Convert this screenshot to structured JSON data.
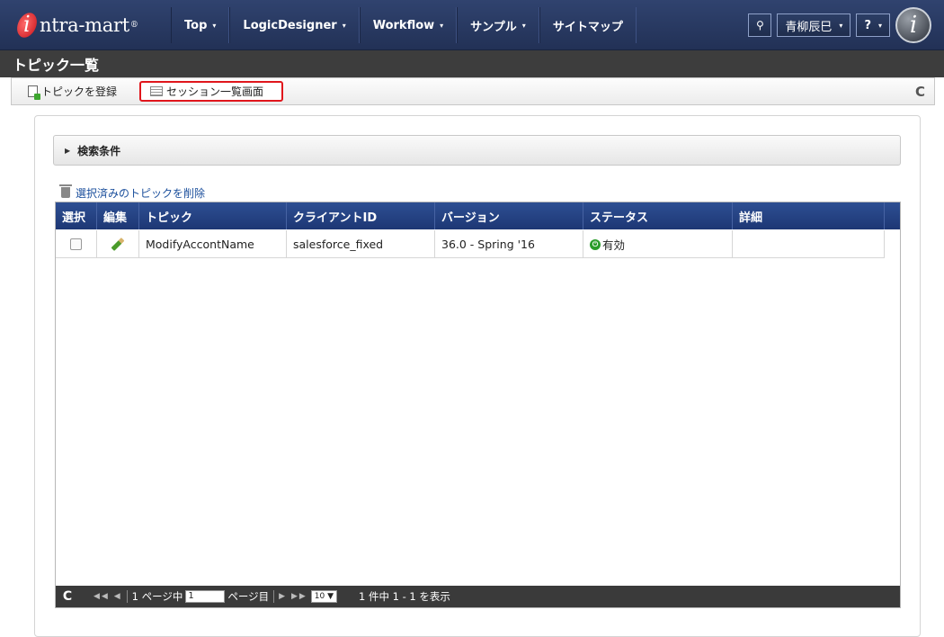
{
  "header": {
    "logo_prefix": "i",
    "logo_text": "ntra-mart",
    "logo_mark": "®",
    "nav": [
      {
        "label": "Top"
      },
      {
        "label": "LogicDesigner"
      },
      {
        "label": "Workflow"
      },
      {
        "label": "サンプル"
      },
      {
        "label": "サイトマップ"
      }
    ],
    "search_icon": "⚲",
    "user_name": "青柳辰巳",
    "help_label": "?",
    "caret": "▾",
    "brand_icon_letter": "i"
  },
  "page": {
    "title": "トピック一覧"
  },
  "toolbar": {
    "register_label": "トピックを登録",
    "session_label": "セッション一覧画面",
    "refresh_icon": "C"
  },
  "search": {
    "toggle_icon": "▶",
    "label": "検索条件"
  },
  "delete_label": "選択済みのトピックを削除",
  "grid": {
    "columns": [
      "選択",
      "編集",
      "トピック",
      "クライアントID",
      "バージョン",
      "ステータス",
      "詳細"
    ],
    "rows": [
      {
        "topic": "ModifyAccontName",
        "client_id": "salesforce_fixed",
        "version": "36.0 - Spring '16",
        "status_icon": "⏻",
        "status": "有効",
        "detail": ""
      }
    ]
  },
  "pager": {
    "refresh_icon": "C",
    "nav_first_prev": "◀◀ ◀",
    "page_prefix": "1 ページ中",
    "page_value": "1",
    "page_suffix": "ページ目",
    "nav_next_last": "▶ ▶▶",
    "per_page": "10 ▼",
    "status": "1 件中 1 - 1 を表示"
  },
  "colors": {
    "nav_bg": "#223156",
    "title_bg": "#3d3d3d",
    "grid_header_bg": "#1d3774",
    "highlight_border": "#e0161c",
    "link": "#1b4f9c",
    "status_ok": "#2a9c2a"
  }
}
